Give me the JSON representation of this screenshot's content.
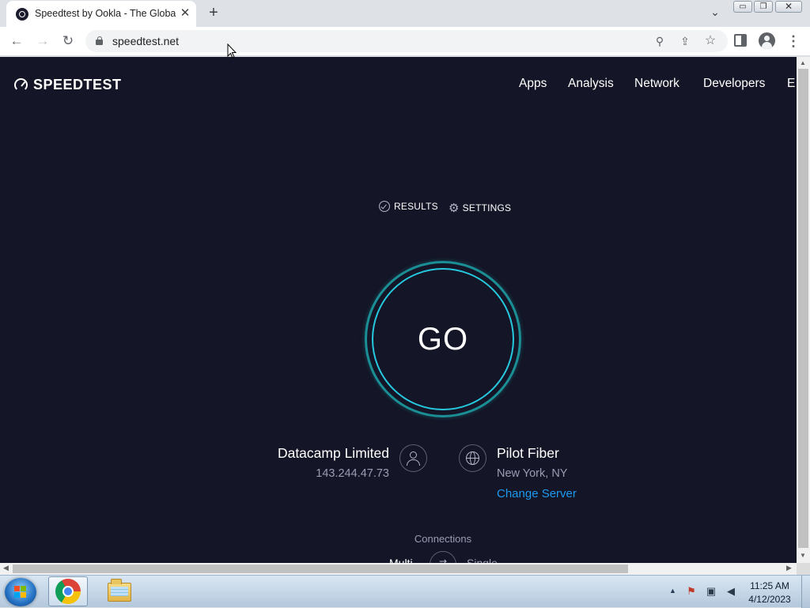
{
  "browser": {
    "tab_title": "Speedtest by Ookla - The Global Broadband Speed Test",
    "tab_close_glyph": "✕",
    "new_tab_glyph": "+",
    "tab_search_glyph": "⌄",
    "window_controls": {
      "minimize": "▭",
      "maximize": "❐",
      "close": "✕"
    },
    "nav": {
      "back": "←",
      "forward": "→",
      "reload": "↻"
    },
    "url": "speedtest.net",
    "omnibox_icons": {
      "zoom": "⚲",
      "share": "⇪",
      "bookmark": "☆"
    },
    "menu_glyph": "⋮"
  },
  "page": {
    "logo_text": "SPEEDTEST",
    "nav_items": [
      "Apps",
      "Analysis",
      "Network",
      "Developers",
      "E"
    ],
    "results_label": "RESULTS",
    "settings_label": "SETTINGS",
    "gear_glyph": "⚙",
    "go_label": "GO",
    "isp": {
      "name": "Datacamp Limited",
      "ip": "143.244.47.73"
    },
    "server": {
      "name": "Pilot Fiber",
      "location": "New York, NY",
      "change_label": "Change Server"
    },
    "connections": {
      "label": "Connections",
      "multi": "Multi",
      "single": "Single",
      "toggle_glyph": "⇄"
    },
    "colors": {
      "background": "#141526",
      "go_ring_outer": "#1b8f96",
      "go_ring_inner": "#26c9e0",
      "link": "#1c9bf0",
      "muted_text": "#9b9cb3"
    }
  },
  "scrollbars": {
    "up": "▲",
    "down": "▼",
    "left": "◀",
    "right": "▶"
  },
  "taskbar": {
    "tray_arrow": "▲",
    "tray_icons": {
      "flag": "⚑",
      "network": "▣",
      "volume": "◀"
    },
    "time": "11:25 AM",
    "date": "4/12/2023"
  }
}
